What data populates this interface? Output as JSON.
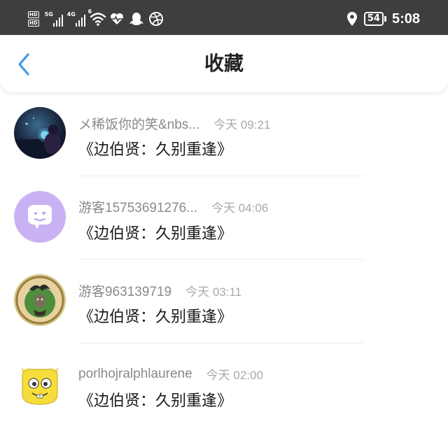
{
  "status_bar": {
    "hd_top": "HD",
    "hd_bottom": "HD",
    "net1": "5G",
    "net2": "4G",
    "wifi_badge": "6",
    "battery": "54",
    "time": "5:08"
  },
  "header": {
    "title": "收藏"
  },
  "items": [
    {
      "username": "メ稀饭你的笑&nbs...",
      "time": "今天 09:21",
      "title": "《边伯贤：久别重逢》"
    },
    {
      "username": "游客15753691276...",
      "time": "今天 04:06",
      "title": "《边伯贤：久别重逢》"
    },
    {
      "username": "游客963139719",
      "time": "今天 03:11",
      "title": "《边伯贤：久别重逢》"
    },
    {
      "username": "porlhojralphlaurene",
      "time": "今天 02:00",
      "title": "《边伯贤：久别重逢》"
    }
  ],
  "colors": {
    "status_bar_bg": "#3e3e3e",
    "back_arrow": "#3d9be9",
    "avatar_purple": "#c9b2f4"
  },
  "icons": [
    "back-chevron-icon",
    "wifi-icon",
    "heart-pulse-icon",
    "qq-penguin-icon",
    "dribbble-icon",
    "location-pin-icon",
    "battery-icon"
  ]
}
